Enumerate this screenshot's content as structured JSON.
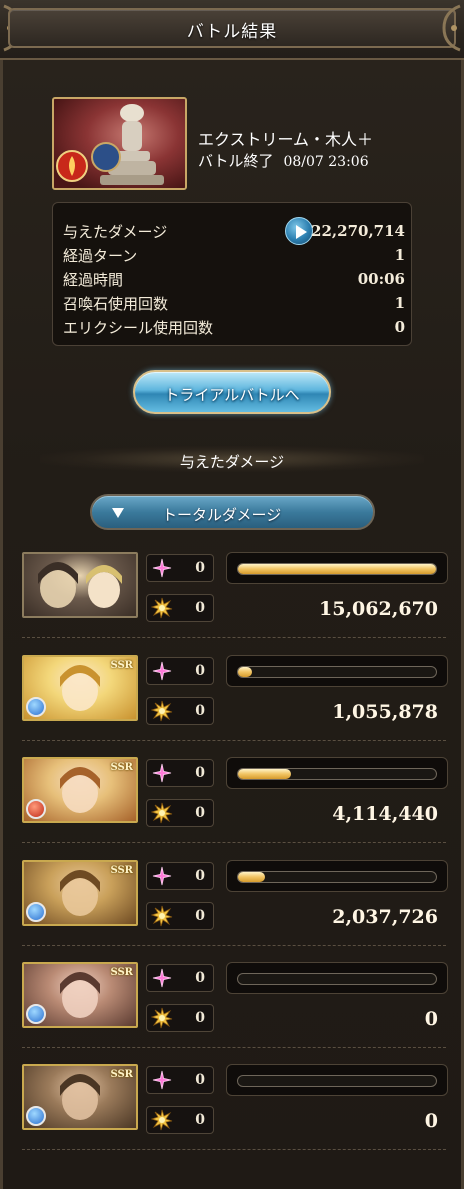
{
  "header": {
    "title": "バトル結果"
  },
  "quest": {
    "name": "エクストリーム・木人＋",
    "end_label": "バトル終了",
    "end_datetime": "08/07 23:06"
  },
  "stats": [
    {
      "label": "与えたダメージ",
      "value": "22,270,714"
    },
    {
      "label": "経過ターン",
      "value": "1"
    },
    {
      "label": "経過時間",
      "value": "00:06"
    },
    {
      "label": "召喚石使用回数",
      "value": "1"
    },
    {
      "label": "エリクシール使用回数",
      "value": "0"
    }
  ],
  "trial_button": {
    "label": "トライアルバトルへ"
  },
  "damage_section": {
    "heading": "与えたダメージ"
  },
  "damage_dropdown": {
    "selected": "トータルダメージ"
  },
  "party": [
    {
      "ca_count": "0",
      "skill_count": "0",
      "damage": "15,062,670",
      "share": 1.0,
      "rarity": "",
      "element": ""
    },
    {
      "ca_count": "0",
      "skill_count": "0",
      "damage": "1,055,878",
      "share": 0.07,
      "rarity": "SSR",
      "element": "water"
    },
    {
      "ca_count": "0",
      "skill_count": "0",
      "damage": "4,114,440",
      "share": 0.27,
      "rarity": "SSR",
      "element": "fire"
    },
    {
      "ca_count": "0",
      "skill_count": "0",
      "damage": "2,037,726",
      "share": 0.135,
      "rarity": "SSR",
      "element": "water"
    },
    {
      "ca_count": "0",
      "skill_count": "0",
      "damage": "0",
      "share": 0.0,
      "rarity": "SSR",
      "element": "water"
    },
    {
      "ca_count": "0",
      "skill_count": "0",
      "damage": "0",
      "share": 0.0,
      "rarity": "SSR",
      "element": "water"
    }
  ],
  "colors": {
    "bar_gold": "#f1c463",
    "accent_blue": "#3b7a9c",
    "frame_gold": "#c9a94f"
  },
  "icons": {
    "ca": "pink-star-icon",
    "skill": "gold-burst-icon",
    "play": "play-icon"
  }
}
